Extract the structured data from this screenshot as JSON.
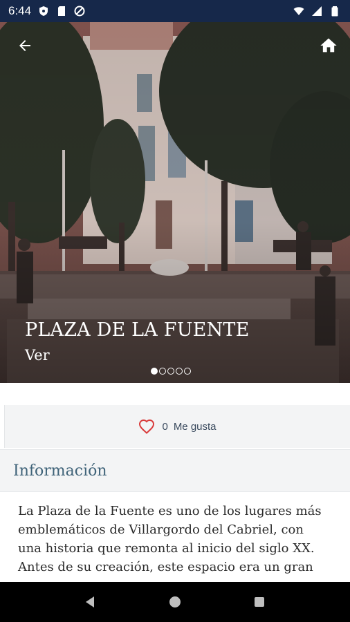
{
  "status_bar": {
    "time": "6:44",
    "left_icons": [
      "shield-icon",
      "sd-card-icon",
      "no-disturb-icon"
    ],
    "right_icons": [
      "wifi-icon",
      "signal-icon",
      "battery-icon"
    ]
  },
  "hero": {
    "title": "PLAZA DE LA FUENTE",
    "subtitle": "Ver",
    "dots_count": 5,
    "active_dot": 0
  },
  "likes": {
    "count": "0",
    "label": "Me gusta"
  },
  "info": {
    "title": "Información",
    "lines": [
      "La Plaza de la Fuente es uno de los lugares más",
      "emblemáticos de Villargordo del Cabriel, con",
      "una historia que remonta al inicio del siglo XX.",
      "Antes de su creación, este espacio era un gran"
    ]
  },
  "colors": {
    "status_bar": "#16284a",
    "accent": "#3e6278",
    "heart": "#d93b3b"
  }
}
